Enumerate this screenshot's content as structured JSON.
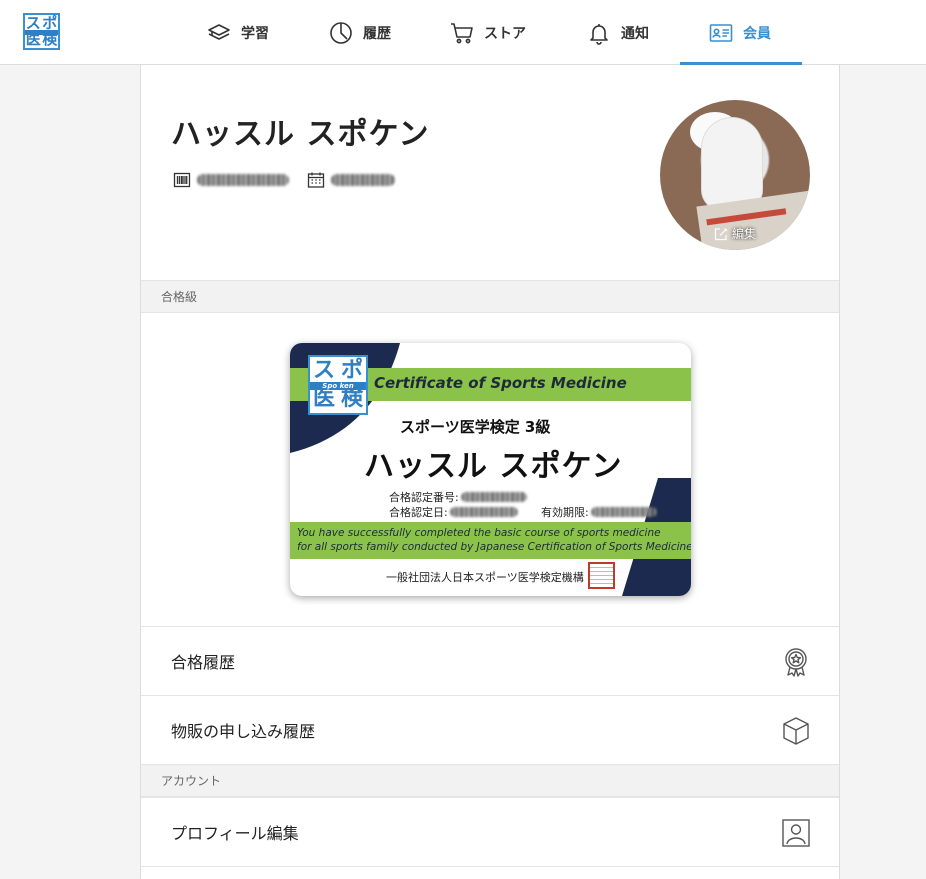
{
  "header": {
    "logo": {
      "chars": [
        "ス",
        "ポ",
        "医",
        "検"
      ]
    },
    "nav": [
      {
        "key": "learn",
        "label": "学習",
        "icon": "layers-icon"
      },
      {
        "key": "history",
        "label": "履歴",
        "icon": "clock-icon"
      },
      {
        "key": "store",
        "label": "ストア",
        "icon": "cart-icon"
      },
      {
        "key": "notify",
        "label": "通知",
        "icon": "bell-icon"
      },
      {
        "key": "member",
        "label": "会員",
        "icon": "id-card-icon",
        "active": true
      }
    ],
    "accent_color": "#3a8fd0"
  },
  "profile": {
    "name": "ハッスル スポケン",
    "avatar_edit_label": "編集"
  },
  "sections": {
    "passed_grade": "合格級",
    "account": "アカウント"
  },
  "certificate": {
    "badge_chars": [
      "ス",
      "ポ",
      "医",
      "検"
    ],
    "badge_band": "Spo ken",
    "title_en": "Certificate of Sports Medicine",
    "grade": "スポーツ医学検定 3級",
    "holder": "ハッスル スポケン",
    "cert_number_label": "合格認定番号:",
    "cert_date_label": "合格認定日:",
    "expiry_label": "有効期限:",
    "message_line1": "You have successfully completed the basic course of sports medicine",
    "message_line2": "for all sports family conducted by Japanese Certification of Sports Medicine.",
    "issuer": "一般社団法人日本スポーツ医学検定機構",
    "green_color": "#8bc34a",
    "navy_color": "#1b2a4e"
  },
  "rows": {
    "pass_history": "合格履歴",
    "purchase_history": "物販の申し込み履歴",
    "profile_edit": "プロフィール編集"
  }
}
